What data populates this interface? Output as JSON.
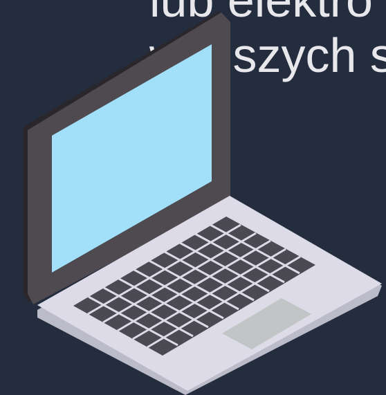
{
  "headline": {
    "line1": "lub elektro",
    "line2": "wyższych s"
  },
  "illustration": {
    "name": "laptop-icon",
    "colors": {
      "background": "#232d3e",
      "text": "#e7e7ec",
      "lid_frame": "#4e4a50",
      "lid_shadow": "#2a272c",
      "screen": "#a2e0fa",
      "deck_top": "#dcdbe7",
      "deck_edge": "#bcbbc9",
      "keys": "#4b4a53",
      "touchpad": "#c2c5c5"
    }
  }
}
